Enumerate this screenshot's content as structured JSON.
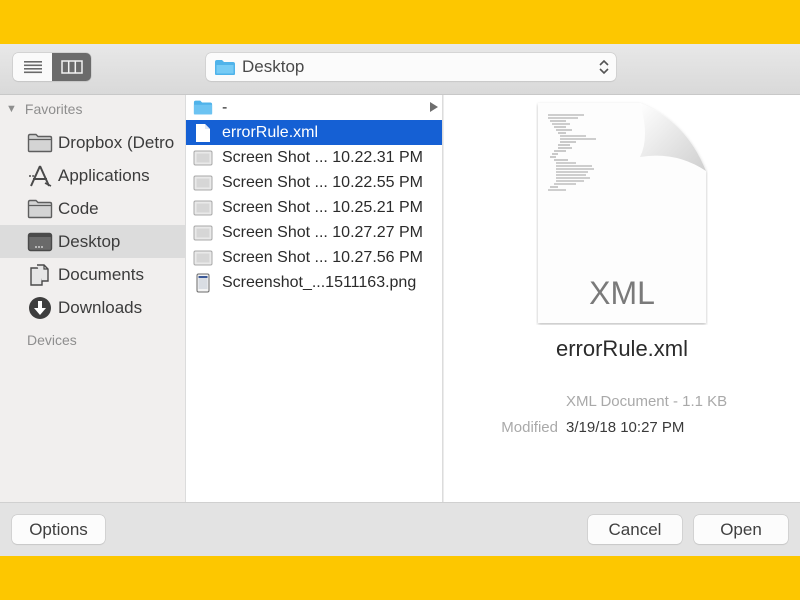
{
  "toolbar": {
    "view_modes": [
      {
        "name": "list-view",
        "icon": "list-icon",
        "selected": false
      },
      {
        "name": "column-view",
        "icon": "columns-icon",
        "selected": true
      }
    ],
    "location": {
      "label": "Desktop",
      "icon": "folder-icon"
    }
  },
  "sidebar": {
    "favorites_label": "Favorites",
    "devices_label": "Devices",
    "items": [
      {
        "label": "Dropbox (Detroit Labs)",
        "display": "Dropbox (Detro",
        "icon": "folder-icon",
        "selected": false
      },
      {
        "label": "Applications",
        "icon": "applications-icon",
        "selected": false
      },
      {
        "label": "Code",
        "icon": "folder-icon",
        "selected": false
      },
      {
        "label": "Desktop",
        "icon": "desktop-icon",
        "selected": true
      },
      {
        "label": "Documents",
        "icon": "documents-icon",
        "selected": false
      },
      {
        "label": "Downloads",
        "icon": "downloads-icon",
        "selected": false
      }
    ]
  },
  "files": [
    {
      "label": "-",
      "icon": "folder-icon",
      "selected": false,
      "has_children": true
    },
    {
      "label": "errorRule.xml",
      "icon": "document-icon",
      "selected": true
    },
    {
      "label": "Screen Shot ... 10.22.31 PM",
      "icon": "image-icon",
      "selected": false
    },
    {
      "label": "Screen Shot ... 10.22.55 PM",
      "icon": "image-icon",
      "selected": false
    },
    {
      "label": "Screen Shot ... 10.25.21 PM",
      "icon": "image-icon",
      "selected": false
    },
    {
      "label": "Screen Shot ... 10.27.27 PM",
      "icon": "image-icon",
      "selected": false
    },
    {
      "label": "Screen Shot ... 10.27.56 PM",
      "icon": "image-icon",
      "selected": false
    },
    {
      "label": "Screenshot_...1511163.png",
      "icon": "phone-image-icon",
      "selected": false
    }
  ],
  "preview": {
    "icon_label": "XML",
    "file_name": "errorRule.xml",
    "kind": "XML Document - 1.1 KB",
    "modified_label": "Modified",
    "modified_value": "3/19/18 10:27 PM"
  },
  "buttons": {
    "options": "Options",
    "cancel": "Cancel",
    "open": "Open"
  },
  "colors": {
    "selection": "#1560d4",
    "background_frame": "#fdc700",
    "folder_blue": "#4fb3ea"
  }
}
